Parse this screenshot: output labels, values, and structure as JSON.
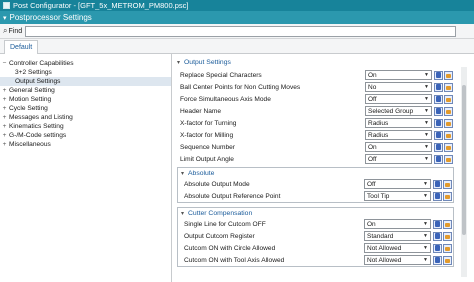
{
  "window": {
    "title": "Post Configurator - [GFT_5x_METROM_PM800.psc]"
  },
  "header": {
    "title": "Postprocessor Settings"
  },
  "find": {
    "label": "Find",
    "value": ""
  },
  "tabs": [
    {
      "label": "Default"
    }
  ],
  "tree": {
    "items": [
      {
        "label": "Controller Capabilities"
      },
      {
        "label": "3+2 Settings"
      },
      {
        "label": "Output Settings"
      },
      {
        "label": "General Setting"
      },
      {
        "label": "Motion Setting"
      },
      {
        "label": "Cycle Setting"
      },
      {
        "label": "Messages and Listing"
      },
      {
        "label": "Kinematics Setting"
      },
      {
        "label": "G-/M-Code settings"
      },
      {
        "label": "Miscellaneous"
      }
    ]
  },
  "output_settings": {
    "title": "Output Settings",
    "rows": [
      {
        "label": "Replace Special Characters",
        "value": "On"
      },
      {
        "label": "Ball Center Points for Non Cutting Moves",
        "value": "No"
      },
      {
        "label": "Force Simultaneous Axis Mode",
        "value": "Off"
      },
      {
        "label": "Header Name",
        "value": "Selected Group"
      },
      {
        "label": "X-factor for Turning",
        "value": "Radius"
      },
      {
        "label": "X-factor for Milling",
        "value": "Radius"
      },
      {
        "label": "Sequence Number",
        "value": "On"
      },
      {
        "label": "Limit Output Angle",
        "value": "Off"
      }
    ]
  },
  "absolute": {
    "title": "Absolute",
    "rows": [
      {
        "label": "Absolute Output Mode",
        "value": "Off"
      },
      {
        "label": "Absolute Output Reference Point",
        "value": "Tool Tip"
      }
    ]
  },
  "cutter_comp": {
    "title": "Cutter Compensation",
    "rows": [
      {
        "label": "Single Line for Cutcom OFF",
        "value": "On"
      },
      {
        "label": "Output Cutcom Register",
        "value": "Standard"
      },
      {
        "label": "Cutcom ON with Circle Allowed",
        "value": "Not Allowed"
      },
      {
        "label": "Cutcom ON with Tool Axis Allowed",
        "value": "Not Allowed"
      }
    ]
  }
}
